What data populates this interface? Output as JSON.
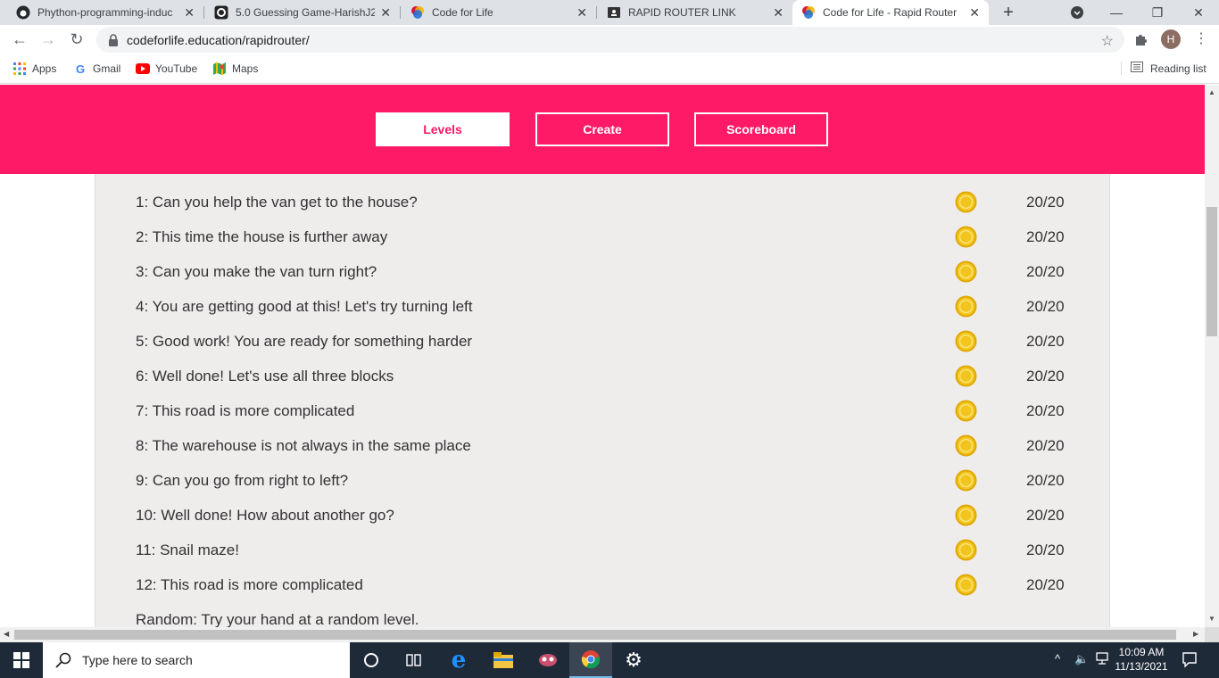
{
  "browser": {
    "tabs": [
      {
        "title": "Phython-programming-induc",
        "active": false,
        "icon": "github-icon"
      },
      {
        "title": "5.0 Guessing Game-HarishJ2",
        "active": false,
        "icon": "replit-icon"
      },
      {
        "title": "Code for Life",
        "active": false,
        "icon": "codeforlife-icon"
      },
      {
        "title": "RAPID ROUTER LINK",
        "active": false,
        "icon": "classroom-icon"
      },
      {
        "title": "Code for Life - Rapid Router",
        "active": true,
        "icon": "codeforlife-icon"
      }
    ],
    "url": "codeforlife.education/rapidrouter/",
    "profile_initial": "H",
    "bookmarks": [
      {
        "label": "Apps",
        "icon": "apps-grid-icon"
      },
      {
        "label": "Gmail",
        "icon": "google-icon"
      },
      {
        "label": "YouTube",
        "icon": "youtube-icon"
      },
      {
        "label": "Maps",
        "icon": "maps-icon"
      }
    ],
    "reading_list": "Reading list"
  },
  "nav": {
    "levels": "Levels",
    "create": "Create",
    "scoreboard": "Scoreboard"
  },
  "levels": [
    {
      "name": "1: Can you help the van get to the house?",
      "score": "20/20",
      "coin": true
    },
    {
      "name": "2: This time the house is further away",
      "score": "20/20",
      "coin": true
    },
    {
      "name": "3: Can you make the van turn right?",
      "score": "20/20",
      "coin": true
    },
    {
      "name": "4: You are getting good at this! Let's try turning left",
      "score": "20/20",
      "coin": true
    },
    {
      "name": "5: Good work! You are ready for something harder",
      "score": "20/20",
      "coin": true
    },
    {
      "name": "6: Well done! Let's use all three blocks",
      "score": "20/20",
      "coin": true
    },
    {
      "name": "7: This road is more complicated",
      "score": "20/20",
      "coin": true
    },
    {
      "name": "8: The warehouse is not always in the same place",
      "score": "20/20",
      "coin": true
    },
    {
      "name": "9: Can you go from right to left?",
      "score": "20/20",
      "coin": true
    },
    {
      "name": "10: Well done! How about another go?",
      "score": "20/20",
      "coin": true
    },
    {
      "name": "11: Snail maze!",
      "score": "20/20",
      "coin": true
    },
    {
      "name": "12: This road is more complicated",
      "score": "20/20",
      "coin": true
    },
    {
      "name": "Random: Try your hand at a random level.",
      "score": "",
      "coin": false
    }
  ],
  "taskbar": {
    "search_placeholder": "Type here to search",
    "time": "10:09 AM",
    "date": "11/13/2021"
  },
  "colors": {
    "brand_pink": "#fe1a66",
    "panel_bg": "#efecec",
    "coin_gold": "#f2c51c"
  }
}
